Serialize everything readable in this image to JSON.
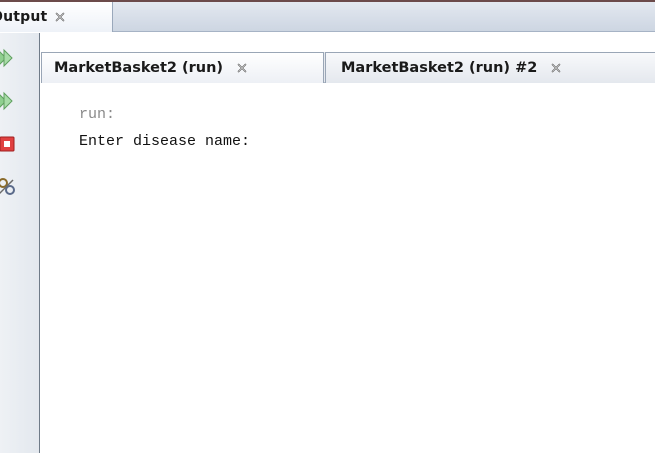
{
  "panel": {
    "title": "Output"
  },
  "sidebar": {
    "buttons": [
      "rerun-icon",
      "rerun-with-options-icon",
      "stop-icon",
      "settings-icon"
    ]
  },
  "run_tabs": [
    {
      "label": "MarketBasket2 (run)"
    },
    {
      "label": "MarketBasket2 (run) #2"
    }
  ],
  "console": {
    "run_line": "run:",
    "prompt_line": "Enter disease name:"
  },
  "colors": {
    "header_gradient_top": "#e3e8f0",
    "stop_red": "#e04040",
    "rerun_green": "#7fc07f"
  }
}
